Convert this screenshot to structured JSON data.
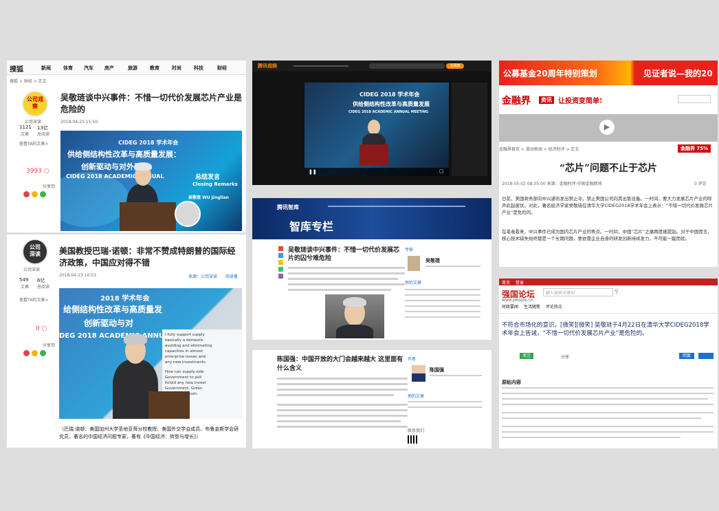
{
  "panel1": {
    "nav": {
      "logo": "搜狐",
      "items": [
        "新闻",
        "体育",
        "汽车",
        "房产",
        "旅游",
        "教育",
        "时尚",
        "科技",
        "财经"
      ]
    },
    "breadcrumb": "搜狐 > 财经 > 正文",
    "author_badge": "公司观察",
    "author_name": "公司深读",
    "author_stats": {
      "articles": "1121",
      "readers": "13亿",
      "articles_label": "文章",
      "readers_label": "总阅读"
    },
    "author_link": "查看TA的文章>",
    "article_title": "吴敬琏谈中兴事件：不惜一切代价发展芯片产业是危险的",
    "article_time": "2018-04-23 15:50",
    "read_count": "3993",
    "photo_banner_lines": [
      "CIDEG 2018 学术年会",
      "供给侧结构性改革与高质量发展：",
      "创新驱动与对外开放",
      "CIDEG 2018 ACADEMIC ANNUAL"
    ],
    "photo_side_text": [
      "总结发言",
      "Closing Remarks",
      "吴敬琏 WU Jinglian"
    ],
    "share_label": "分享到"
  },
  "panel2": {
    "author_name": "公司深读",
    "author_stats": {
      "articles": "549",
      "readers": "6亿",
      "articles_label": "文章",
      "readers_label": "总阅读"
    },
    "author_link": "查看TA的文章>",
    "article_title": "美国教授巴瑞·诺顿：非常不赞成特朗普的国际经济政策，中国应对得不错",
    "article_time": "2018-04-23 10:53",
    "meta_links": [
      "来源：公司深读",
      "阅读量"
    ],
    "comment_count": "0",
    "share_label": "分享到",
    "photo_banner_lines": [
      "2018 学术年会",
      "给侧结构性改革与高质量发",
      "创新驱动与对",
      "DEG 2018 ACADEMIC ANNUAL"
    ],
    "screen_text": [
      "I fully support supply",
      "basically a domestic",
      "avoiding and eliminating",
      "capacities in almost",
      "enterprise losses and",
      "any new investments",
      "How can supply-side",
      "Government to pull",
      "forbid any new invest",
      "Government. Green",
      "be negative-sum."
    ],
    "caption": "（巴瑞·诺顿：美国加州大学圣地亚哥分校教授、美国外交学会成员、布鲁金斯学会研究员、著名的中国经济问题专家，著有《中国经济：转型与增长》）"
  },
  "panel3": {
    "site_logo": "腾讯视频",
    "search_button": "全网搜",
    "video_title": "CIDEG 2018 学术年会",
    "video_subtitle": "供给侧结构性改革与高质量发展",
    "video_banner": "CIDEG 2018 ACADEMIC ANNUAL MEETING"
  },
  "panel4": {
    "site_logo": "腾讯智库",
    "column_title": "智库专栏",
    "article_title": "吴敬琏谈中兴事件：不惜一切代价发展芯片的囚兮难危险",
    "expert_name": "吴敬琏",
    "sidebar_label": "专家",
    "other_label": "他的文章"
  },
  "panel5": {
    "article_title": "陈国强：中国开放的大门会越来越大 这里面有什么含义",
    "expert_name": "陈国强",
    "sidebar_label": "作者",
    "other_label": "他的文章",
    "contact_label": "联系我们"
  },
  "panel6": {
    "banner_left": "公募基金20周年特别策划",
    "banner_right": "见证者说—我的20",
    "logo": "金融界",
    "logo_sub": "资讯",
    "slogan": "让投资变简单!",
    "breadcrumb": "金融界首页 > 滚动新闻 > 经济时评 > 正文",
    "badge": "金融界 75%",
    "headline": "“芯片”问题不止于芯片",
    "meta": "2018-05-02 08:35:00  来源：金融时评-中国金融新闻",
    "comment_count": "0 评论",
    "paragraphs": [
      "日前，美国商务部向中兴通讯发出禁止令，禁止美国公司向其出售设备。一时间，要大力发展芯片产业的呼声此起彼伏。对此，著名经济学家吴敬琏在清华大学CIDEG2018学术年会上表示：“不惜一切代价发展芯片产业”是危险的。",
      "在笔者看来，中兴事件已成为国内芯片产业的焦点。一时间，中国“芯片”之痛再度被提起。对于中国而言，核心技术缺失始终都是一个长期问题，要依靠企业自身的研发创新持续发力，不可能一蹴而就。"
    ]
  },
  "panel7": {
    "top_links": [
      "首页",
      "登录"
    ],
    "logo": "强国论坛",
    "logo_sub": "www.people.cn",
    "search_placeholder": "输入搜索关键词",
    "nav": [
      "时政要闻",
      "生活随笔",
      "评论热点"
    ],
    "title": "不符合市场化的意识。[微笑][微笑] 吴敬琏于4月22日在清华大学CIDEG2018学术年会上告诫，“不惜一切代价发展芯片产业”是危险的。",
    "btn_follow": "关注",
    "btn_reply": "回复",
    "btn_share": "分享",
    "section": "原帖内容"
  }
}
